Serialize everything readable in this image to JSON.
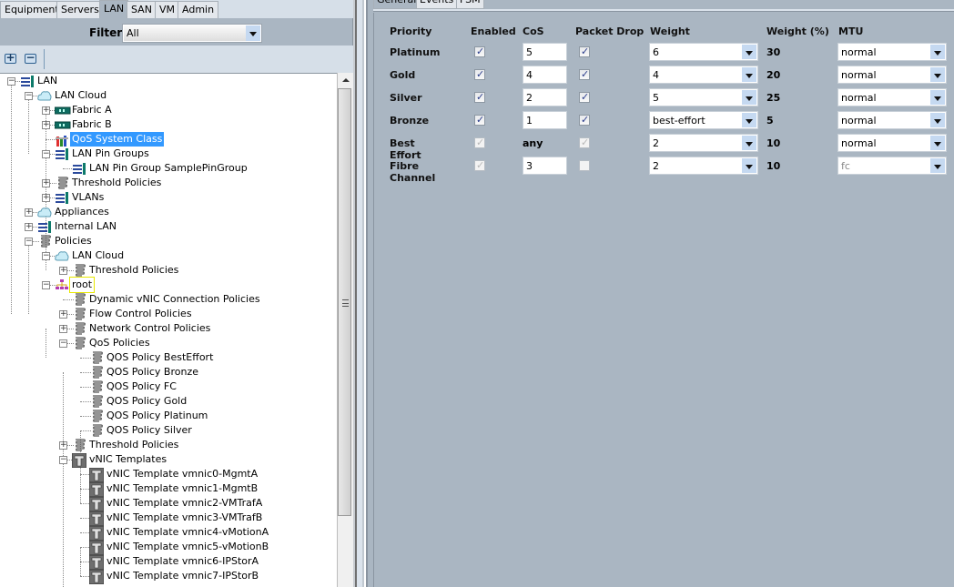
{
  "left_tabs": [
    "Equipment",
    "Servers",
    "LAN",
    "SAN",
    "VM",
    "Admin"
  ],
  "active_left_tab": "LAN",
  "filter": {
    "label": "Filter:",
    "value": "All"
  },
  "toolbar": {
    "expand_icon": "plus-icon",
    "collapse_icon": "minus-icon"
  },
  "tree": [
    {
      "label": "LAN",
      "depth": 0,
      "icon": "lan-icon",
      "expander": "minus"
    },
    {
      "label": "LAN Cloud",
      "depth": 1,
      "icon": "cloud-icon",
      "expander": "minus"
    },
    {
      "label": "Fabric A",
      "depth": 2,
      "icon": "fabric-icon",
      "expander": "plus"
    },
    {
      "label": "Fabric B",
      "depth": 2,
      "icon": "fabric-icon",
      "expander": "plus"
    },
    {
      "label": "QoS System Class",
      "depth": 2,
      "icon": "qos-icon",
      "expander": "none",
      "selected": true
    },
    {
      "label": "LAN Pin Groups",
      "depth": 2,
      "icon": "lan-icon",
      "expander": "minus"
    },
    {
      "label": "LAN Pin Group SamplePinGroup",
      "depth": 3,
      "icon": "lan-icon",
      "expander": "none"
    },
    {
      "label": "Threshold Policies",
      "depth": 2,
      "icon": "policy-icon",
      "expander": "plus"
    },
    {
      "label": "VLANs",
      "depth": 2,
      "icon": "lan-icon",
      "expander": "plus"
    },
    {
      "label": "Appliances",
      "depth": 1,
      "icon": "cloud-icon",
      "expander": "plus"
    },
    {
      "label": "Internal LAN",
      "depth": 1,
      "icon": "lan-icon",
      "expander": "plus"
    },
    {
      "label": "Policies",
      "depth": 1,
      "icon": "policy-icon",
      "expander": "minus"
    },
    {
      "label": "LAN Cloud",
      "depth": 2,
      "icon": "cloud-icon",
      "expander": "minus"
    },
    {
      "label": "Threshold Policies",
      "depth": 3,
      "icon": "policy-icon",
      "expander": "plus"
    },
    {
      "label": "root",
      "depth": 2,
      "icon": "org-icon",
      "expander": "minus",
      "focused": true
    },
    {
      "label": "Dynamic vNIC Connection Policies",
      "depth": 3,
      "icon": "policy-icon",
      "expander": "none"
    },
    {
      "label": "Flow Control Policies",
      "depth": 3,
      "icon": "policy-icon",
      "expander": "plus"
    },
    {
      "label": "Network Control Policies",
      "depth": 3,
      "icon": "policy-icon",
      "expander": "plus"
    },
    {
      "label": "QoS Policies",
      "depth": 3,
      "icon": "policy-icon",
      "expander": "minus"
    },
    {
      "label": "QOS Policy BestEffort",
      "depth": 4,
      "icon": "policy-icon",
      "expander": "none"
    },
    {
      "label": "QOS Policy Bronze",
      "depth": 4,
      "icon": "policy-icon",
      "expander": "none"
    },
    {
      "label": "QOS Policy FC",
      "depth": 4,
      "icon": "policy-icon",
      "expander": "none"
    },
    {
      "label": "QOS Policy Gold",
      "depth": 4,
      "icon": "policy-icon",
      "expander": "none"
    },
    {
      "label": "QOS Policy Platinum",
      "depth": 4,
      "icon": "policy-icon",
      "expander": "none"
    },
    {
      "label": "QOS Policy Silver",
      "depth": 4,
      "icon": "policy-icon",
      "expander": "none"
    },
    {
      "label": "Threshold Policies",
      "depth": 3,
      "icon": "policy-icon",
      "expander": "plus"
    },
    {
      "label": "vNIC Templates",
      "depth": 3,
      "icon": "template-icon",
      "expander": "minus"
    },
    {
      "label": "vNIC Template vmnic0-MgmtA",
      "depth": 4,
      "icon": "template-icon",
      "expander": "none"
    },
    {
      "label": "vNIC Template vmnic1-MgmtB",
      "depth": 4,
      "icon": "template-icon",
      "expander": "none"
    },
    {
      "label": "vNIC Template vmnic2-VMTrafA",
      "depth": 4,
      "icon": "template-icon",
      "expander": "none"
    },
    {
      "label": "vNIC Template vmnic3-VMTrafB",
      "depth": 4,
      "icon": "template-icon",
      "expander": "none"
    },
    {
      "label": "vNIC Template vmnic4-vMotionA",
      "depth": 4,
      "icon": "template-icon",
      "expander": "none"
    },
    {
      "label": "vNIC Template vmnic5-vMotionB",
      "depth": 4,
      "icon": "template-icon",
      "expander": "none"
    },
    {
      "label": "vNIC Template vmnic6-IPStorA",
      "depth": 4,
      "icon": "template-icon",
      "expander": "none"
    },
    {
      "label": "vNIC Template vmnic7-IPStorB",
      "depth": 4,
      "icon": "template-icon",
      "expander": "none"
    }
  ],
  "right_tabs": [
    "General",
    "Events",
    "FSM"
  ],
  "active_right_tab": "General",
  "qos": {
    "headers": [
      "Priority",
      "Enabled",
      "CoS",
      "Packet Drop",
      "Weight",
      "Weight (%)",
      "MTU"
    ],
    "rows": [
      {
        "priority": "Platinum",
        "enabled": true,
        "enabled_editable": true,
        "cos": "5",
        "cos_editable": true,
        "packet_drop": true,
        "packet_drop_editable": true,
        "weight": "6",
        "weight_pct": "30",
        "mtu": "normal",
        "mtu_editable": true
      },
      {
        "priority": "Gold",
        "enabled": true,
        "enabled_editable": true,
        "cos": "4",
        "cos_editable": true,
        "packet_drop": true,
        "packet_drop_editable": true,
        "weight": "4",
        "weight_pct": "20",
        "mtu": "normal",
        "mtu_editable": true
      },
      {
        "priority": "Silver",
        "enabled": true,
        "enabled_editable": true,
        "cos": "2",
        "cos_editable": true,
        "packet_drop": true,
        "packet_drop_editable": true,
        "weight": "5",
        "weight_pct": "25",
        "mtu": "normal",
        "mtu_editable": true
      },
      {
        "priority": "Bronze",
        "enabled": true,
        "enabled_editable": true,
        "cos": "1",
        "cos_editable": true,
        "packet_drop": true,
        "packet_drop_editable": true,
        "weight": "best-effort",
        "weight_pct": "5",
        "mtu": "normal",
        "mtu_editable": true
      },
      {
        "priority": "Best Effort",
        "enabled": true,
        "enabled_editable": false,
        "cos": "any",
        "cos_editable": false,
        "packet_drop": true,
        "packet_drop_editable": false,
        "weight": "2",
        "weight_pct": "10",
        "mtu": "normal",
        "mtu_editable": true
      },
      {
        "priority": "Fibre Channel",
        "enabled": true,
        "enabled_editable": false,
        "cos": "3",
        "cos_editable": true,
        "packet_drop": false,
        "packet_drop_editable": false,
        "weight": "2",
        "weight_pct": "10",
        "mtu": "fc",
        "mtu_editable": false
      }
    ]
  },
  "colors": {
    "selection": "#3399ff",
    "panel_bg": "#aab6c2",
    "tree_bg": "#ffffff",
    "dropdown_button": "#c5d9f1"
  }
}
